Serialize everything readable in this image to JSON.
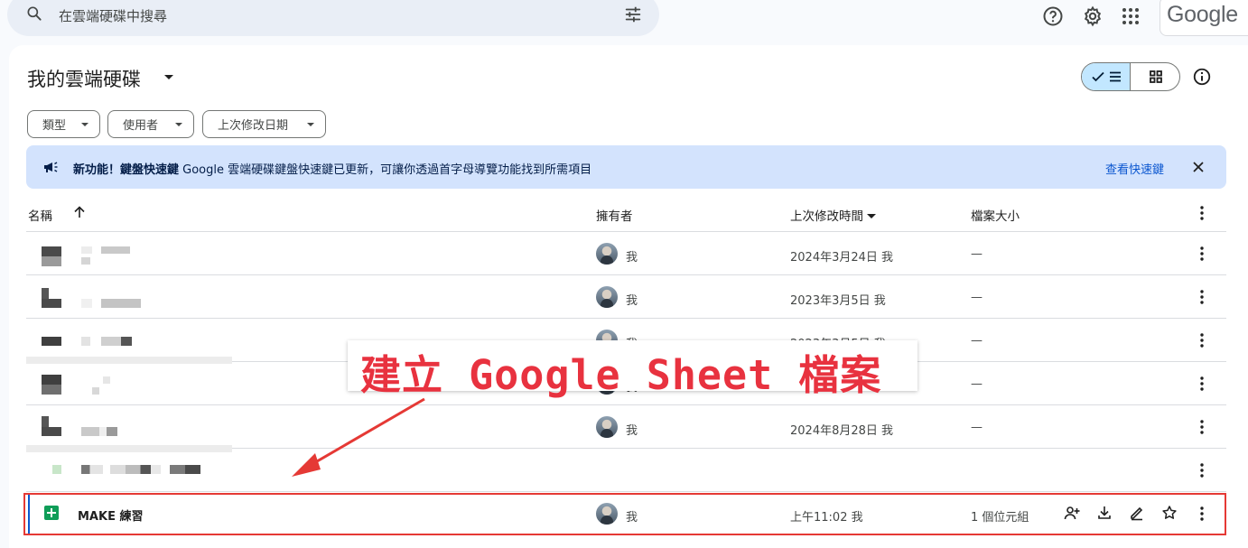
{
  "search": {
    "placeholder": "在雲端硬碟中搜尋"
  },
  "brand": {
    "logo_text": "Google"
  },
  "header": {
    "title": "我的雲端硬碟"
  },
  "filters": [
    {
      "label": "類型"
    },
    {
      "label": "使用者"
    },
    {
      "label": "上次修改日期"
    }
  ],
  "banner": {
    "title": "新功能！鍵盤快速鍵",
    "text": " Google 雲端硬碟鍵盤快速鍵已更新，可讓你透過首字母導覽功能找到所需項目",
    "link": "查看快速鍵"
  },
  "columns": {
    "name": "名稱",
    "owner": "擁有者",
    "modified": "上次修改時間",
    "size": "檔案大小"
  },
  "rows": [
    {
      "owner": "我",
      "modified": "2024年3月24日 我",
      "size": "—"
    },
    {
      "owner": "我",
      "modified": "2023年3月5日 我",
      "size": "—"
    },
    {
      "owner": "我",
      "modified": "2023年3月5日 我",
      "size": "—"
    },
    {
      "owner": "我",
      "modified": "",
      "size": "—"
    },
    {
      "owner": "我",
      "modified": "2024年8月28日 我",
      "size": "—"
    },
    {
      "owner": "",
      "modified": "",
      "size": ""
    },
    {
      "name": "MAKE 練習",
      "owner": "我",
      "modified": "上午11:02 我",
      "size": "1 個位元組"
    }
  ],
  "annotation": {
    "text": "建立 Google Sheet 檔案"
  },
  "colors": {
    "accent": "#0b57d0",
    "highlight": "#e53935",
    "sheets_green": "#0f9d58",
    "banner_bg": "#d3e3fd"
  },
  "icons": [
    "search-icon",
    "tune-icon",
    "help-icon",
    "settings-icon",
    "apps-icon",
    "check-icon",
    "list-icon",
    "grid-icon",
    "info-icon",
    "megaphone-icon",
    "close-icon",
    "arrow-up-icon",
    "more-vert-icon",
    "share-icon",
    "download-icon",
    "rename-icon",
    "star-icon",
    "sheets-icon"
  ]
}
